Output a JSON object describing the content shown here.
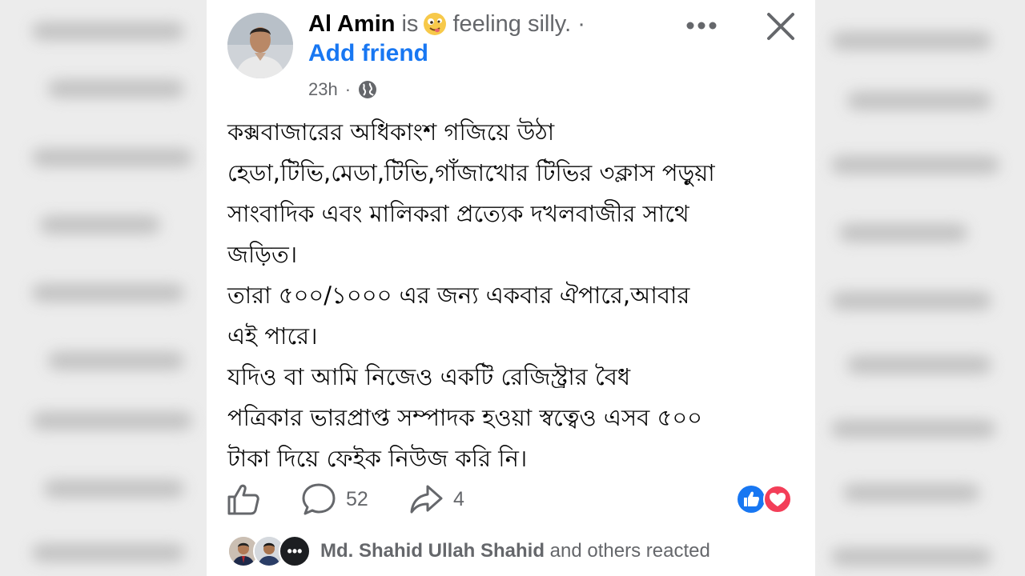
{
  "post": {
    "author": "Al Amin",
    "verb": "is",
    "feeling_emoji": "silly-face-emoji",
    "feeling": "feeling silly.",
    "separator": "·",
    "add_friend": "Add friend",
    "time": "23h",
    "meta_separator": "·",
    "audience_icon": "globe-icon",
    "more_icon": "more-options-icon",
    "close_icon": "close-icon",
    "lines": [
      "কক্সবাজারের অধিকাংশ গজিয়ে উঠা",
      "হেডা,টিভি,মেডা,টিভি,গাঁজাখোর টিভির ৩ক্লাস পড়ুয়া",
      "সাংবাদিক এবং মালিকরা প্রত্যেক দখলবাজীর সাথে",
      "জড়িত।",
      "তারা ৫০০/১০০০ এর জন্য একবার ঐপারে,আবার",
      "এই পারে।",
      "যদিও বা আমি নিজেও একটি রেজিস্ট্রার বৈধ",
      "পত্রিকার ভারপ্রাপ্ত সম্পাদক হওয়া স্বত্বেও এসব ৫০০",
      "টাকা দিয়ে ফেইক নিউজ করি নি।"
    ],
    "actions": {
      "like_icon": "thumbs-up-icon",
      "comment_icon": "comment-icon",
      "comment_count": "52",
      "share_icon": "share-icon",
      "share_count": "4",
      "reaction_icons": [
        "like-reaction-icon",
        "love-reaction-icon"
      ]
    },
    "reacted": {
      "name": "Md. Shahid Ullah Shahid",
      "suffix": " and others reacted",
      "more_glyph": "•••"
    }
  },
  "colors": {
    "link_blue": "#1877f2",
    "secondary_text": "#65676b",
    "primary_text": "#050505",
    "love_red": "#f33e58"
  }
}
